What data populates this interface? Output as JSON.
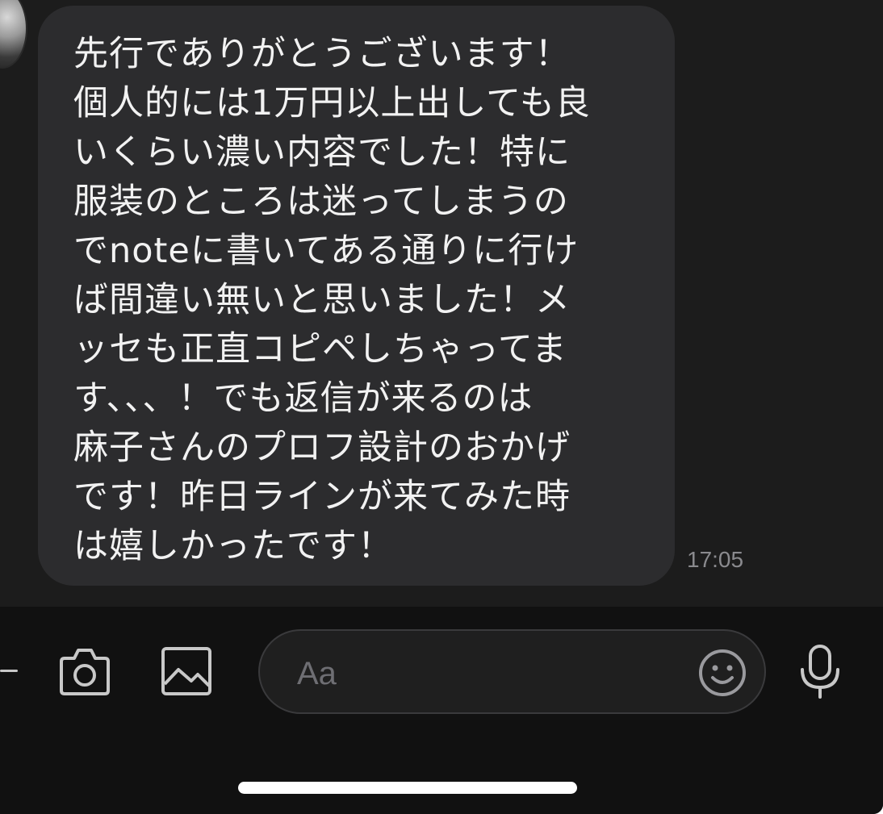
{
  "message": {
    "text": "先行でありがとうございます！\n個人的には1万円以上出しても良\nいくらい濃い内容でした！特に\n服装のところは迷ってしまうの\nでnoteに書いてある通りに行け\nば間違い無いと思いました！メ\nッセも正直コピペしちゃってま\nす、、、！でも返信が来るのは\n麻子さんのプロフ設計のおかげ\nです！昨日ラインが来てみた時\nは嬉しかったです！",
    "time": "17:05"
  },
  "composer": {
    "placeholder": "Aa"
  },
  "icons": {
    "camera": "camera-icon",
    "image": "image-icon",
    "emoji": "emoji-icon",
    "mic": "microphone-icon",
    "plus": "plus-icon"
  },
  "colors": {
    "background": "#1c1c1c",
    "bubble": "#2c2c2e",
    "input_bar": "#111111",
    "text": "#f2f2f2",
    "muted": "#8a8a8e"
  }
}
